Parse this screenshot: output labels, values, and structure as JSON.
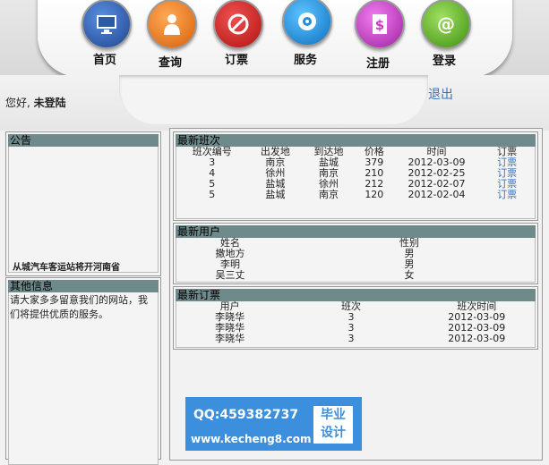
{
  "nav": {
    "items": [
      {
        "label": "首页",
        "icon": "monitor-icon",
        "color": "#2c5aa8"
      },
      {
        "label": "查询",
        "icon": "user-icon",
        "color": "#ee7a1a"
      },
      {
        "label": "订票",
        "icon": "no-sign-icon",
        "color": "#d62020"
      },
      {
        "label": "服务",
        "icon": "disc-icon",
        "color": "#1e8fd6"
      },
      {
        "label": "注册",
        "icon": "dollar-icon",
        "color": "#c93cc4"
      },
      {
        "label": "登录",
        "icon": "at-icon",
        "color": "#66b82a"
      }
    ]
  },
  "header": {
    "greeting_prefix": "您好,",
    "greeting_user": "未登陆",
    "logout": "退出"
  },
  "notice": {
    "title": "公告",
    "scroll_text": "从城汽车客运站将开河南省"
  },
  "other_info": {
    "title": "其他信息",
    "text": "请大家多多留意我们的网站，我们将提供优质的服务。"
  },
  "latest_trips": {
    "title": "最新班次",
    "columns": [
      "班次编号",
      "出发地",
      "到达地",
      "价格",
      "时间",
      "订票"
    ],
    "rows": [
      [
        "3",
        "南京",
        "盐城",
        "379",
        "2012-03-09",
        "订票"
      ],
      [
        "4",
        "徐州",
        "南京",
        "210",
        "2012-02-25",
        "订票"
      ],
      [
        "5",
        "盐城",
        "徐州",
        "212",
        "2012-02-07",
        "订票"
      ],
      [
        "5",
        "盐城",
        "南京",
        "120",
        "2012-02-04",
        "订票"
      ]
    ]
  },
  "latest_users": {
    "title": "最新用户",
    "columns": [
      "姓名",
      "性别"
    ],
    "rows": [
      [
        "撒地方",
        "男"
      ],
      [
        "李明",
        "男"
      ],
      [
        "吴三丈",
        "女"
      ]
    ]
  },
  "latest_orders": {
    "title": "最新订票",
    "columns": [
      "用户",
      "班次",
      "班次时间"
    ],
    "rows": [
      [
        "李晓华",
        "3",
        "2012-03-09"
      ],
      [
        "李晓华",
        "3",
        "2012-03-09"
      ],
      [
        "李晓华",
        "3",
        "2012-03-09"
      ]
    ]
  },
  "watermark": {
    "qq": "QQ:459382737",
    "url": "www.kecheng8.com",
    "box_line1": "毕业",
    "box_line2": "设计"
  }
}
